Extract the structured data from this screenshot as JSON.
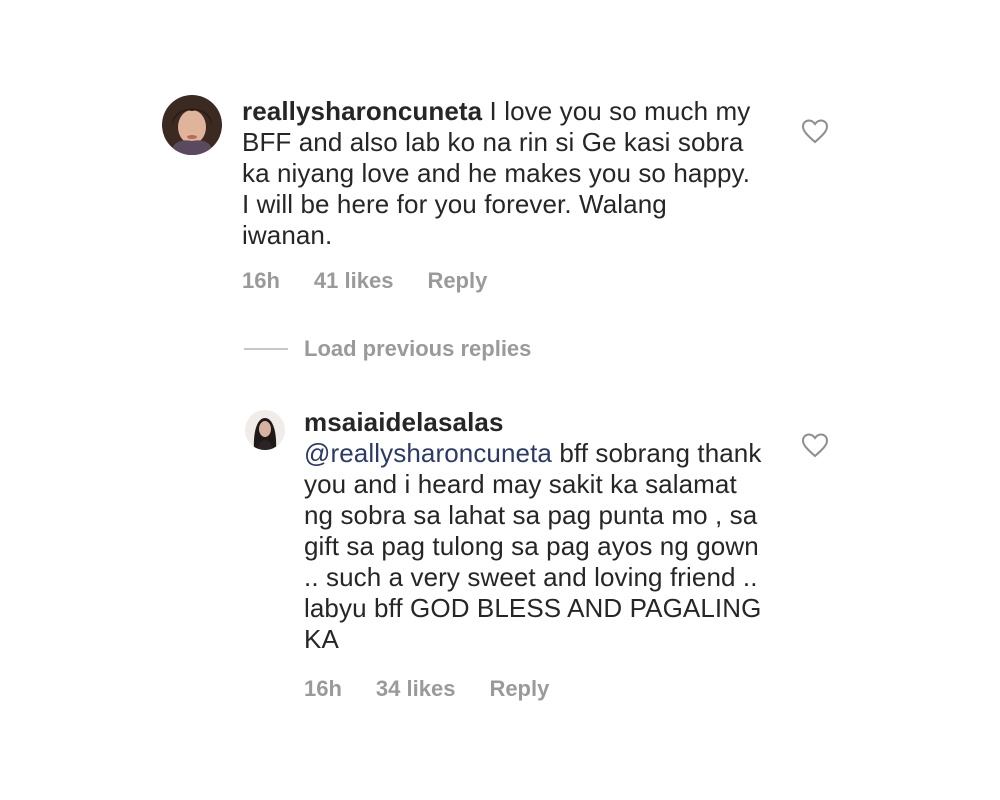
{
  "comments": [
    {
      "username": "reallysharoncuneta",
      "text": " I love you so much my BFF and also lab ko na rin si Ge kasi sobra ka niyang love and he makes you so happy. I will be here for you forever. Walang iwanan.",
      "time": "16h",
      "likes": "41 likes",
      "reply": "Reply"
    },
    {
      "username": "msaiaidelasalas",
      "mention": "@reallysharoncuneta",
      "text": " bff sobrang thank you and i heard may sakit ka salamat ng sobra sa lahat sa pag punta mo , sa gift sa pag tulong sa pag ayos ng gown .. such a very sweet and loving friend .. labyu bff GOD BLESS AND PAGALING KA",
      "time": "16h",
      "likes": "34 likes",
      "reply": "Reply"
    }
  ],
  "load_previous": "Load previous replies",
  "icons": {
    "like": "heart-outline-icon",
    "avatar": "avatar-icon"
  },
  "colors": {
    "meta_text": "#9a9a9a",
    "mention": "#2b3a67",
    "body_text": "#262626"
  }
}
